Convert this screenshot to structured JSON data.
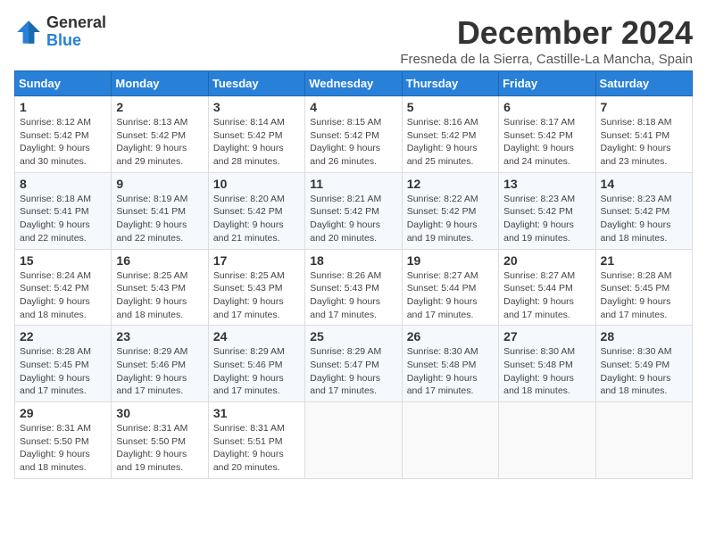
{
  "logo": {
    "general": "General",
    "blue": "Blue"
  },
  "title": "December 2024",
  "subtitle": "Fresneda de la Sierra, Castille-La Mancha, Spain",
  "days_of_week": [
    "Sunday",
    "Monday",
    "Tuesday",
    "Wednesday",
    "Thursday",
    "Friday",
    "Saturday"
  ],
  "weeks": [
    [
      {
        "day": "1",
        "info": "Sunrise: 8:12 AM\nSunset: 5:42 PM\nDaylight: 9 hours\nand 30 minutes."
      },
      {
        "day": "2",
        "info": "Sunrise: 8:13 AM\nSunset: 5:42 PM\nDaylight: 9 hours\nand 29 minutes."
      },
      {
        "day": "3",
        "info": "Sunrise: 8:14 AM\nSunset: 5:42 PM\nDaylight: 9 hours\nand 28 minutes."
      },
      {
        "day": "4",
        "info": "Sunrise: 8:15 AM\nSunset: 5:42 PM\nDaylight: 9 hours\nand 26 minutes."
      },
      {
        "day": "5",
        "info": "Sunrise: 8:16 AM\nSunset: 5:42 PM\nDaylight: 9 hours\nand 25 minutes."
      },
      {
        "day": "6",
        "info": "Sunrise: 8:17 AM\nSunset: 5:42 PM\nDaylight: 9 hours\nand 24 minutes."
      },
      {
        "day": "7",
        "info": "Sunrise: 8:18 AM\nSunset: 5:41 PM\nDaylight: 9 hours\nand 23 minutes."
      }
    ],
    [
      {
        "day": "8",
        "info": "Sunrise: 8:18 AM\nSunset: 5:41 PM\nDaylight: 9 hours\nand 22 minutes."
      },
      {
        "day": "9",
        "info": "Sunrise: 8:19 AM\nSunset: 5:41 PM\nDaylight: 9 hours\nand 22 minutes."
      },
      {
        "day": "10",
        "info": "Sunrise: 8:20 AM\nSunset: 5:42 PM\nDaylight: 9 hours\nand 21 minutes."
      },
      {
        "day": "11",
        "info": "Sunrise: 8:21 AM\nSunset: 5:42 PM\nDaylight: 9 hours\nand 20 minutes."
      },
      {
        "day": "12",
        "info": "Sunrise: 8:22 AM\nSunset: 5:42 PM\nDaylight: 9 hours\nand 19 minutes."
      },
      {
        "day": "13",
        "info": "Sunrise: 8:23 AM\nSunset: 5:42 PM\nDaylight: 9 hours\nand 19 minutes."
      },
      {
        "day": "14",
        "info": "Sunrise: 8:23 AM\nSunset: 5:42 PM\nDaylight: 9 hours\nand 18 minutes."
      }
    ],
    [
      {
        "day": "15",
        "info": "Sunrise: 8:24 AM\nSunset: 5:42 PM\nDaylight: 9 hours\nand 18 minutes."
      },
      {
        "day": "16",
        "info": "Sunrise: 8:25 AM\nSunset: 5:43 PM\nDaylight: 9 hours\nand 18 minutes."
      },
      {
        "day": "17",
        "info": "Sunrise: 8:25 AM\nSunset: 5:43 PM\nDaylight: 9 hours\nand 17 minutes."
      },
      {
        "day": "18",
        "info": "Sunrise: 8:26 AM\nSunset: 5:43 PM\nDaylight: 9 hours\nand 17 minutes."
      },
      {
        "day": "19",
        "info": "Sunrise: 8:27 AM\nSunset: 5:44 PM\nDaylight: 9 hours\nand 17 minutes."
      },
      {
        "day": "20",
        "info": "Sunrise: 8:27 AM\nSunset: 5:44 PM\nDaylight: 9 hours\nand 17 minutes."
      },
      {
        "day": "21",
        "info": "Sunrise: 8:28 AM\nSunset: 5:45 PM\nDaylight: 9 hours\nand 17 minutes."
      }
    ],
    [
      {
        "day": "22",
        "info": "Sunrise: 8:28 AM\nSunset: 5:45 PM\nDaylight: 9 hours\nand 17 minutes."
      },
      {
        "day": "23",
        "info": "Sunrise: 8:29 AM\nSunset: 5:46 PM\nDaylight: 9 hours\nand 17 minutes."
      },
      {
        "day": "24",
        "info": "Sunrise: 8:29 AM\nSunset: 5:46 PM\nDaylight: 9 hours\nand 17 minutes."
      },
      {
        "day": "25",
        "info": "Sunrise: 8:29 AM\nSunset: 5:47 PM\nDaylight: 9 hours\nand 17 minutes."
      },
      {
        "day": "26",
        "info": "Sunrise: 8:30 AM\nSunset: 5:48 PM\nDaylight: 9 hours\nand 17 minutes."
      },
      {
        "day": "27",
        "info": "Sunrise: 8:30 AM\nSunset: 5:48 PM\nDaylight: 9 hours\nand 18 minutes."
      },
      {
        "day": "28",
        "info": "Sunrise: 8:30 AM\nSunset: 5:49 PM\nDaylight: 9 hours\nand 18 minutes."
      }
    ],
    [
      {
        "day": "29",
        "info": "Sunrise: 8:31 AM\nSunset: 5:50 PM\nDaylight: 9 hours\nand 18 minutes."
      },
      {
        "day": "30",
        "info": "Sunrise: 8:31 AM\nSunset: 5:50 PM\nDaylight: 9 hours\nand 19 minutes."
      },
      {
        "day": "31",
        "info": "Sunrise: 8:31 AM\nSunset: 5:51 PM\nDaylight: 9 hours\nand 20 minutes."
      },
      {
        "day": "",
        "info": ""
      },
      {
        "day": "",
        "info": ""
      },
      {
        "day": "",
        "info": ""
      },
      {
        "day": "",
        "info": ""
      }
    ]
  ]
}
